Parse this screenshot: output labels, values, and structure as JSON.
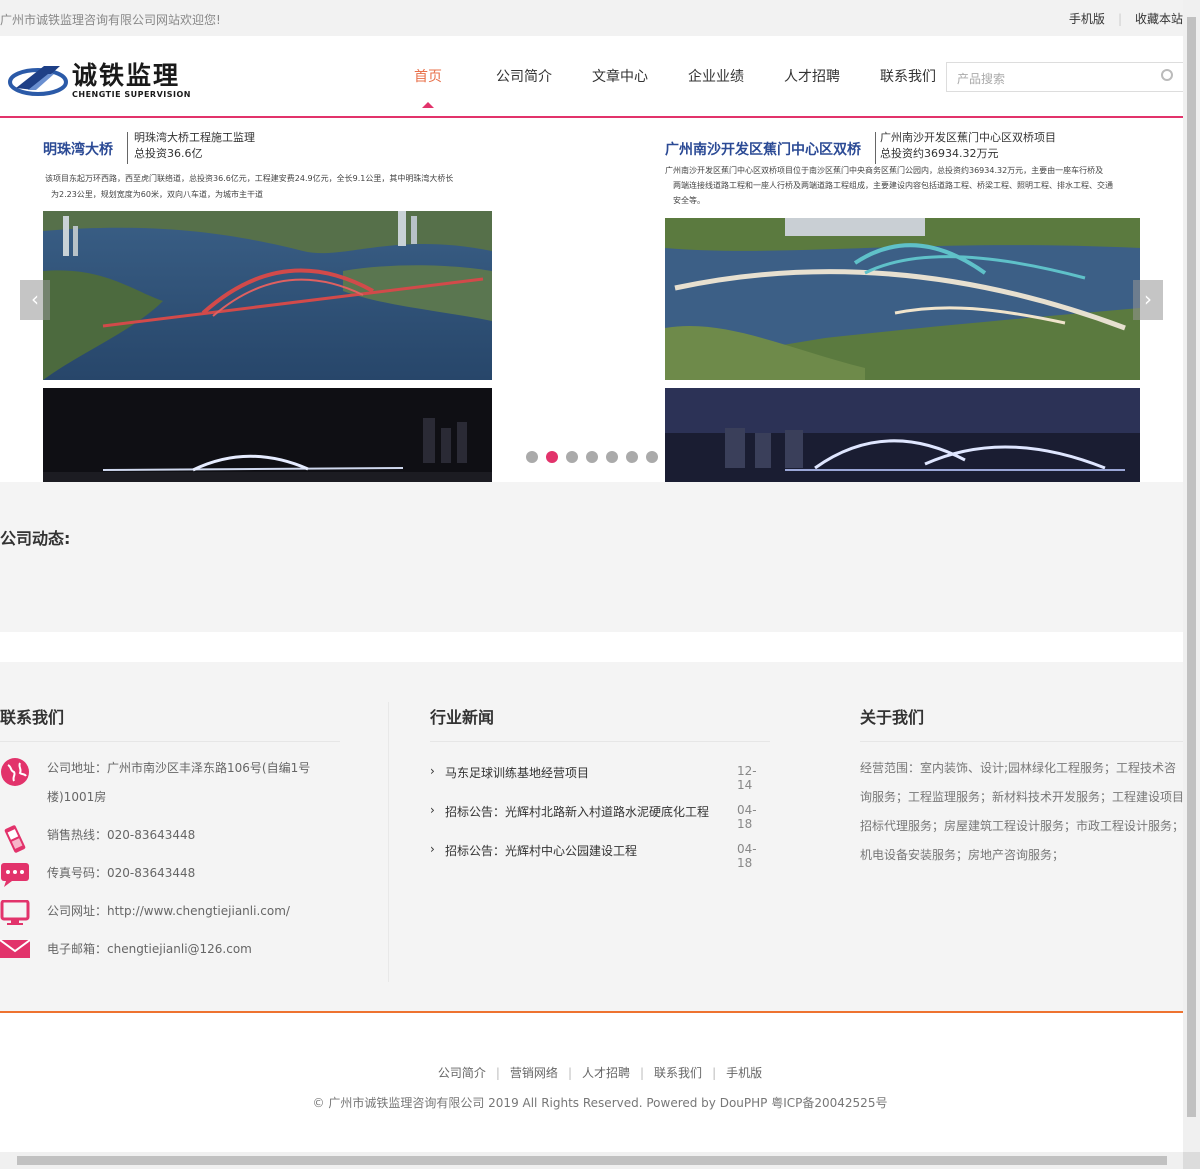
{
  "topbar": {
    "welcome": "广州市诚铁监理咨询有限公司网站欢迎您!",
    "links": [
      "手机版",
      "收藏本站"
    ]
  },
  "logo": {
    "cn": "诚铁监理",
    "en": "CHENGTIE SUPERVISION"
  },
  "nav": {
    "items": [
      "首页",
      "公司简介",
      "文章中心",
      "企业业绩",
      "人才招聘",
      "联系我们"
    ],
    "active_index": 0
  },
  "search": {
    "placeholder": "产品搜索"
  },
  "banner": {
    "left": {
      "title": "明珠湾大桥",
      "sub1": "明珠湾大桥工程施工监理",
      "sub2": "总投资36.6亿",
      "desc1": "该项目东起万环西路，西至虎门联络道，总投资36.6亿元，工程建安费24.9亿元，全长9.1公里，其中明珠湾大桥长",
      "desc2": "为2.23公里，规划宽度为60米，双向八车道，为城市主干道"
    },
    "right": {
      "title": "广州南沙开发区蕉门中心区双桥",
      "sub1": "广州南沙开发区蕉门中心区双桥项目",
      "sub2": "总投资约36934.32万元",
      "desc1": "广州南沙开发区蕉门中心区双桥项目位于南沙区蕉门中央商务区蕉门公园内，总投资约36934.32万元，主要由一座车行桥及",
      "desc2": "两端连接线道路工程和一座人行桥及两端道路工程组成，主要建设内容包括道路工程、桥梁工程、照明工程、排水工程、交通",
      "desc3": "安全等。"
    },
    "arrows": {
      "prev": "‹",
      "next": "›"
    },
    "slide_count": 7,
    "active_slide": 1
  },
  "news": {
    "title": "公司动态:"
  },
  "footer": {
    "contact": {
      "title": "联系我们",
      "address": "公司地址：广州市南沙区丰泽东路106号(自编1号楼)1001房",
      "hotline": "销售热线：020-83643448",
      "fax": "传真号码：020-83643448",
      "website": "公司网址：http://www.chengtiejianli.com/",
      "email": "电子邮箱：chengtiejianli@126.com"
    },
    "industry": {
      "title": "行业新闻",
      "items": [
        {
          "title": "马东足球训练基地经营项目",
          "date": "12-14"
        },
        {
          "title": "招标公告：光辉村北路新入村道路水泥硬底化工程",
          "date": "04-18"
        },
        {
          "title": "招标公告：光辉村中心公园建设工程",
          "date": "04-18"
        }
      ]
    },
    "about": {
      "title": "关于我们",
      "text": "经营范围：室内装饰、设计;园林绿化工程服务；工程技术咨询服务；工程监理服务；新材料技术开发服务；工程建设项目招标代理服务；房屋建筑工程设计服务；市政工程设计服务；机电设备安装服务；房地产咨询服务；"
    }
  },
  "bottom": {
    "links": [
      "公司简介",
      "营销网络",
      "人才招聘",
      "联系我们",
      "手机版"
    ],
    "copyright": "© 广州市诚铁监理咨询有限公司 2019 All Rights Reserved. Powered by DouPHP 粤ICP备20042525号"
  },
  "colors": {
    "accent": "#e2336b",
    "active_nav": "#e8704a",
    "footer_rule": "#ee7330",
    "title_blue": "#2b4a95"
  }
}
